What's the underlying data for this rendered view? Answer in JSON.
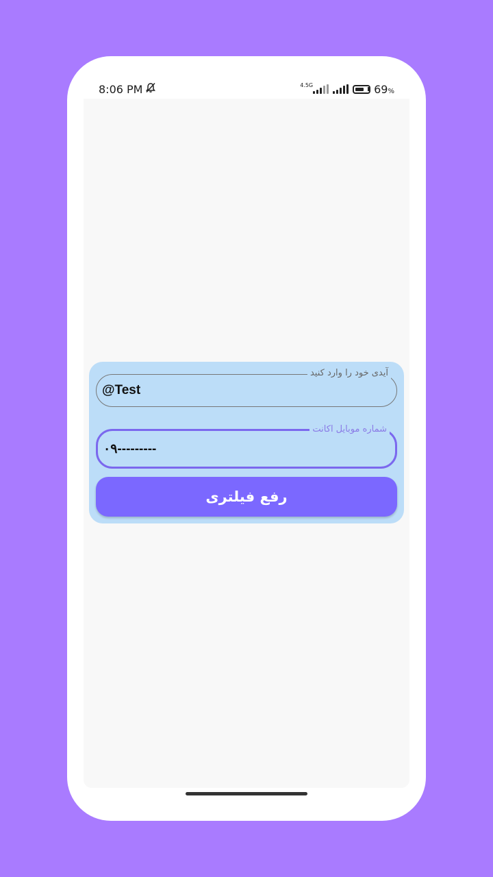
{
  "status_bar": {
    "time": "8:06 PM",
    "network_label": "4.5G",
    "battery_level": 0.69,
    "battery_percent": "69",
    "battery_percent_sign": "%",
    "icons": [
      "bell-off-icon",
      "signal-icon",
      "battery-icon"
    ]
  },
  "form": {
    "id_field": {
      "label": "آیدی خود را وارد کنید",
      "value": "@Test"
    },
    "phone_field": {
      "label": "شماره موبایل اکانت",
      "value": "۰۹---------"
    },
    "submit_label": "رفع فیلتری"
  },
  "colors": {
    "background": "#a97bff",
    "card": "#bcddf8",
    "accent": "#7b68ff",
    "focused_border": "#7b68ee"
  }
}
